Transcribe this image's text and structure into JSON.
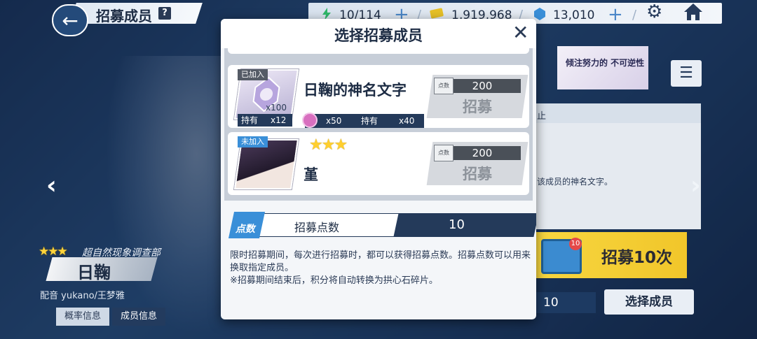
{
  "header": {
    "title": "招募成员",
    "help": "?",
    "stamina": "10/114",
    "coins": "1,919,968",
    "gems": "13,010",
    "plus": "+",
    "slash": "/"
  },
  "character": {
    "org": "超自然现象调查部",
    "name": "日鞠",
    "cv": "配音 yukano/王梦雅",
    "stars": "★★★",
    "tab_prob": "概率信息",
    "tab_member": "成员信息"
  },
  "right_panel": {
    "banner_title": "倾注努力的 不可逆性",
    "info1": "止",
    "info2": "该成员的神名文字。",
    "recruit10": "招募10次",
    "mail_badge": "10",
    "points": "10",
    "select": "选择成员"
  },
  "modal": {
    "title": "选择招募成员",
    "close": "✕",
    "cards": [
      {
        "tag": "已加入",
        "name": "日鞠的神名文字",
        "x_count": "x100",
        "hold_label": "持有",
        "hold_qty": "x12",
        "gem_qty": "x50",
        "gem_hold_label": "持有",
        "gem_hold_qty": "x40",
        "cost": "200",
        "cost_icon": "点数",
        "recruit": "招募"
      },
      {
        "tag": "未加入",
        "name": "堇",
        "stars": "★★★",
        "cost": "200",
        "cost_icon": "点数",
        "recruit": "招募"
      }
    ],
    "points_icon": "点数",
    "points_label": "招募点数",
    "points_value": "10",
    "desc1": "限时招募期间，每次进行招募时，都可以获得招募点数。招募点数可以用来换取指定成员。",
    "desc2": "※招募期间结束后，积分将自动转换为拱心石碎片。"
  }
}
